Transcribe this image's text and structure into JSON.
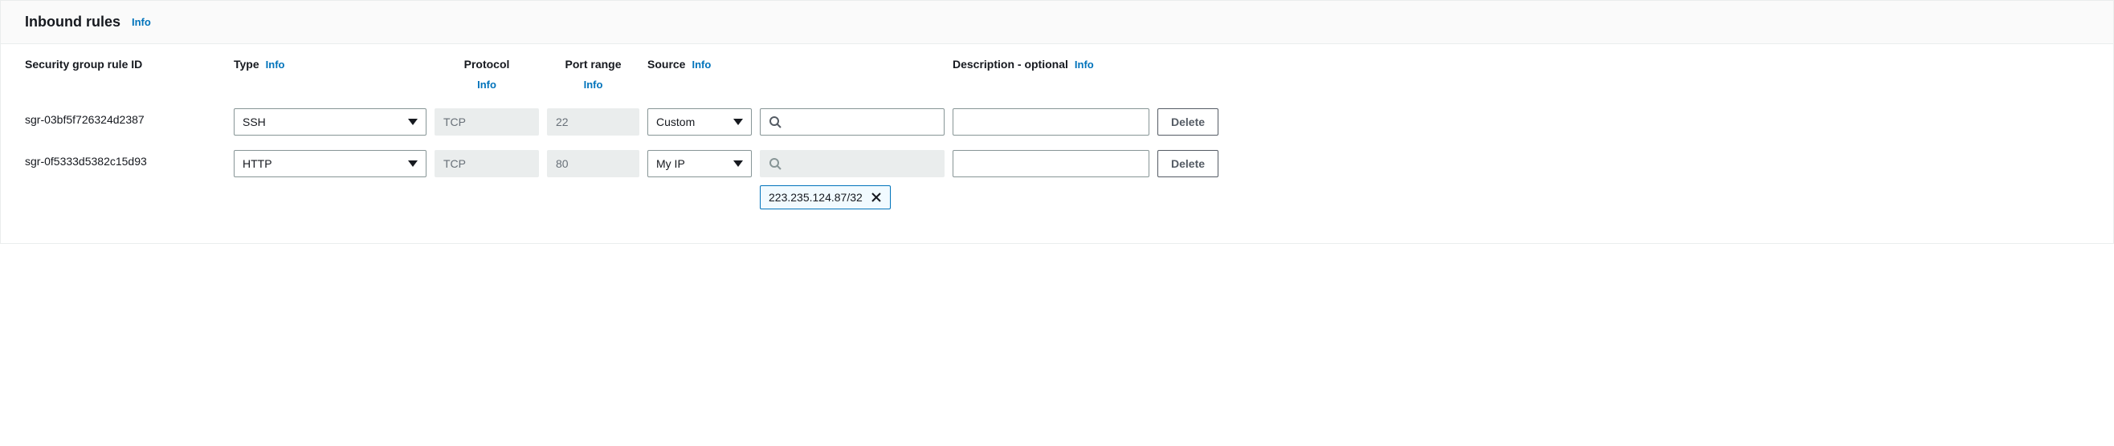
{
  "panel": {
    "title": "Inbound rules",
    "info_label": "Info"
  },
  "columns": {
    "rule_id": "Security group rule ID",
    "type": "Type",
    "protocol": "Protocol",
    "port_range": "Port range",
    "source": "Source",
    "description": "Description - optional",
    "info_label": "Info"
  },
  "actions": {
    "delete_label": "Delete"
  },
  "rules": [
    {
      "id": "sgr-03bf5f726324d2387",
      "type": "SSH",
      "protocol": "TCP",
      "port_range": "22",
      "source_mode": "Custom",
      "source_value": "",
      "source_search_disabled": false,
      "description": "",
      "tokens": []
    },
    {
      "id": "sgr-0f5333d5382c15d93",
      "type": "HTTP",
      "protocol": "TCP",
      "port_range": "80",
      "source_mode": "My IP",
      "source_value": "",
      "source_search_disabled": true,
      "description": "",
      "tokens": [
        "223.235.124.87/32"
      ]
    }
  ]
}
